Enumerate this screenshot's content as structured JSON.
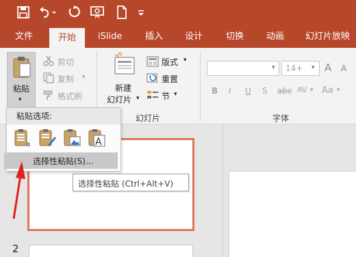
{
  "quick_access": {
    "icons": [
      "save-icon",
      "undo-icon",
      "redo-icon",
      "present-from-beginning-icon",
      "new-file-icon",
      "customize-qat-icon"
    ],
    "accent": "#b7472a"
  },
  "tabs": [
    {
      "label": "文件"
    },
    {
      "label": "开始",
      "active": true
    },
    {
      "label": "iSlide"
    },
    {
      "label": "插入"
    },
    {
      "label": "设计"
    },
    {
      "label": "切换"
    },
    {
      "label": "动画"
    },
    {
      "label": "幻灯片放映"
    }
  ],
  "clipboard": {
    "paste_label": "粘贴",
    "cut_label": "剪切",
    "copy_label": "复制",
    "copy_arrow": "▾",
    "format_painter_label": "格式刷"
  },
  "slides_group": {
    "new_slide_line1": "新建",
    "new_slide_line2": "幻灯片",
    "new_slide_arrow": "▾",
    "layout_label": "版式",
    "layout_arrow": "▾",
    "reset_label": "重置",
    "section_label": "节",
    "section_arrow": "▾",
    "group_name": "幻灯片"
  },
  "font_group": {
    "font_name_value": "",
    "font_size_value": "14+",
    "grow_label": "A",
    "shrink_label": "A",
    "bold": "B",
    "italic": "I",
    "underline": "U",
    "shadow": "S",
    "strikethrough": "abc",
    "spacing": "AV",
    "case": "Aa",
    "group_name": "字体"
  },
  "paste_menu": {
    "header": "粘贴选项:",
    "options": [
      "use-destination-theme-icon",
      "keep-source-formatting-icon",
      "picture-icon",
      "keep-text-only-icon"
    ],
    "selective_paste_label": "选择性粘贴(S)..."
  },
  "tooltip": {
    "text": "选择性粘贴 (Ctrl+Alt+V)"
  },
  "slide_panel": {
    "slide2_number": "2"
  },
  "colors": {
    "ribbon_red": "#b7472a",
    "selection_border": "#e1735a",
    "arrow_red": "#e02020"
  }
}
